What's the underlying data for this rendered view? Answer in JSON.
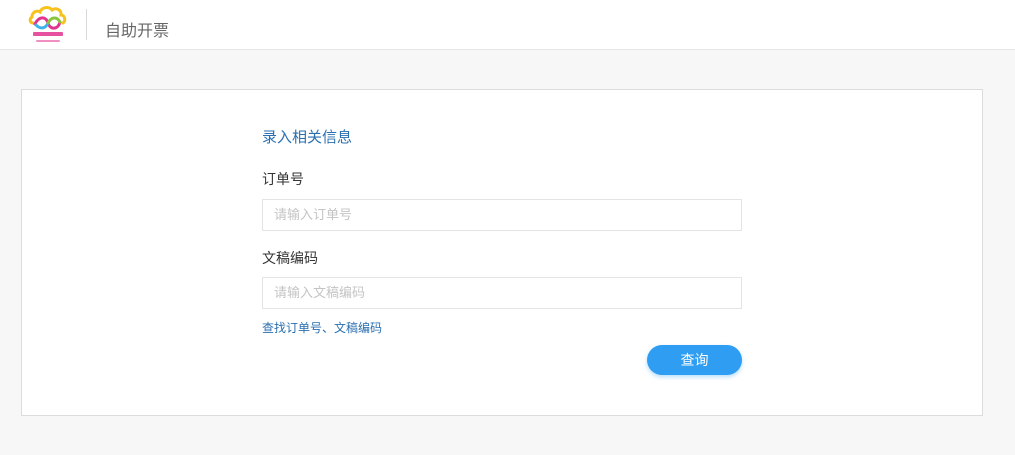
{
  "header": {
    "title": "自助开票",
    "logo_icon": "cloud-logo-icon"
  },
  "form": {
    "title": "录入相关信息",
    "order_label": "订单号",
    "order_value": "",
    "order_placeholder": "请输入订单号",
    "doc_label": "文稿编码",
    "doc_value": "",
    "doc_placeholder": "请输入文稿编码",
    "help_link": "查找订单号、文稿编码",
    "query_button": "查询"
  },
  "colors": {
    "accent": "#2f9ef2",
    "link": "#2a6fb0"
  }
}
